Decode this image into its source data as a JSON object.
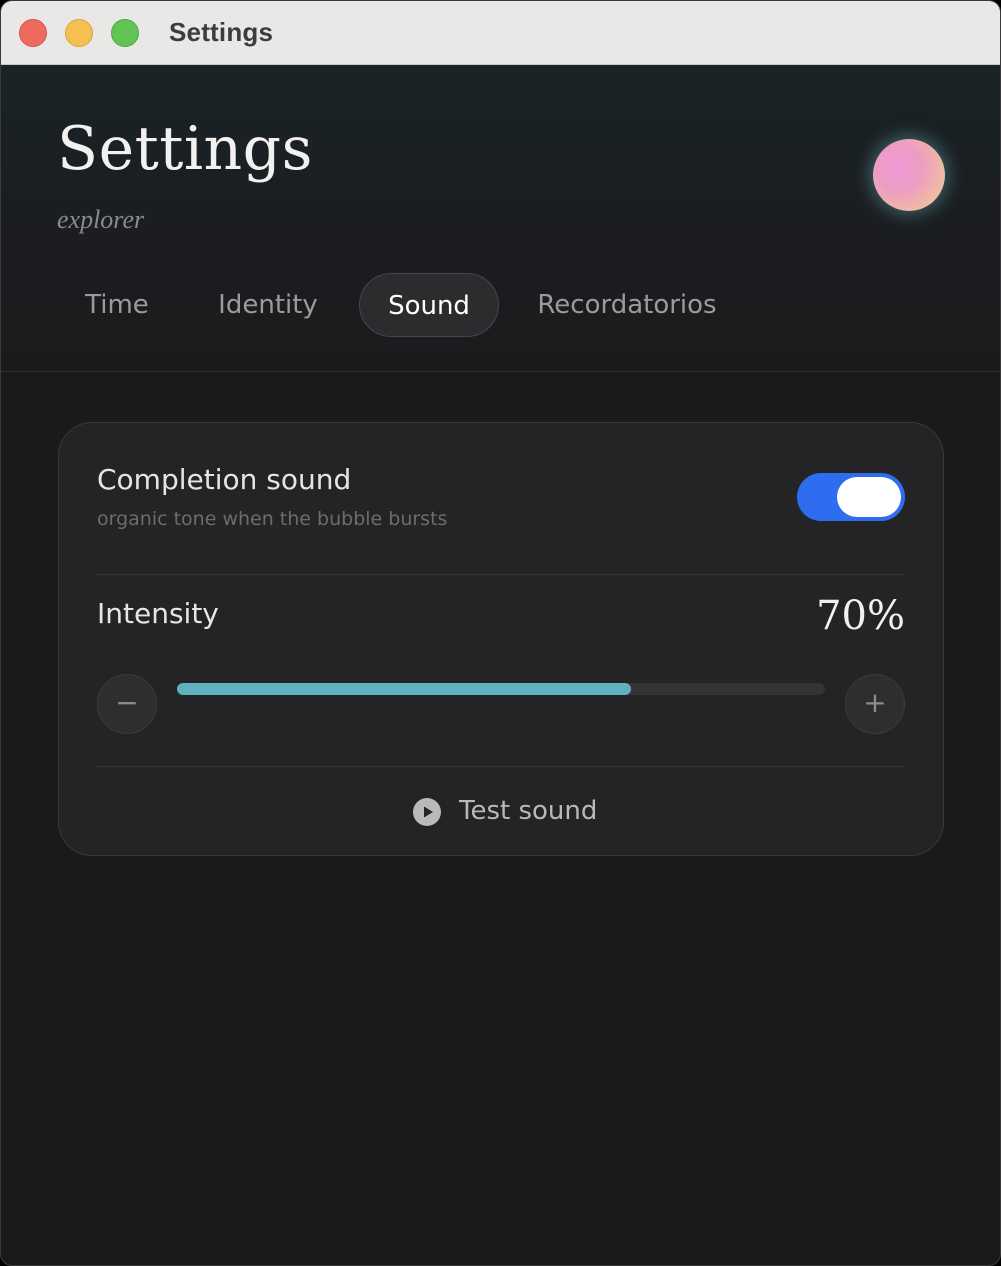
{
  "window": {
    "title": "Settings"
  },
  "header": {
    "title": "Settings",
    "subtitle": "explorer",
    "avatar_icon": "gradient-orb-avatar"
  },
  "tabs": [
    {
      "label": "Time",
      "active": false
    },
    {
      "label": "Identity",
      "active": false
    },
    {
      "label": "Sound",
      "active": true
    },
    {
      "label": "Recordatorios",
      "active": false
    }
  ],
  "sound": {
    "completion": {
      "title": "Completion sound",
      "description": "organic tone when the bubble bursts",
      "enabled": true
    },
    "intensity": {
      "label": "Intensity",
      "value_text": "70%",
      "value": 0.7,
      "minus_label": "−",
      "plus_label": "+"
    },
    "test": {
      "label": "Test sound",
      "icon": "play-icon"
    }
  },
  "colors": {
    "accent_blue": "#2f6df0",
    "slider_fill": "#5fb1c0",
    "background": "#1a191b",
    "card": "#242325"
  }
}
